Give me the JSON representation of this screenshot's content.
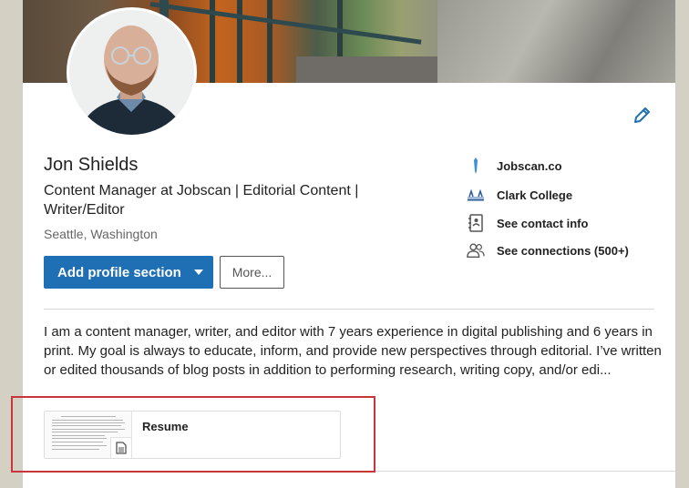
{
  "profile": {
    "name": "Jon Shields",
    "headline": "Content Manager at Jobscan | Editorial Content | Writer/Editor",
    "location": "Seattle, Washington"
  },
  "actions": {
    "add_section_label": "Add profile section",
    "more_label": "More..."
  },
  "side_info": [
    {
      "label": "Jobscan.co",
      "icon": "company-icon"
    },
    {
      "label": "Clark College",
      "icon": "school-icon"
    },
    {
      "label": "See contact info",
      "icon": "contact-card-icon"
    },
    {
      "label": "See connections (500+)",
      "icon": "connections-icon"
    }
  ],
  "summary": "I am a content manager, writer, and editor with 7 years experience in digital publishing and 6 years in print. My goal is always to educate, inform, and provide new perspectives through editorial. I’ve written or edited thousands of blog posts in addition to performing research, writing copy, and/or edi...",
  "attachment": {
    "title": "Resume",
    "icon": "document-icon"
  },
  "colors": {
    "primary_button": "#1f6fb5",
    "highlight_border": "#c8353a",
    "link_blue": "#1f6fb5"
  }
}
